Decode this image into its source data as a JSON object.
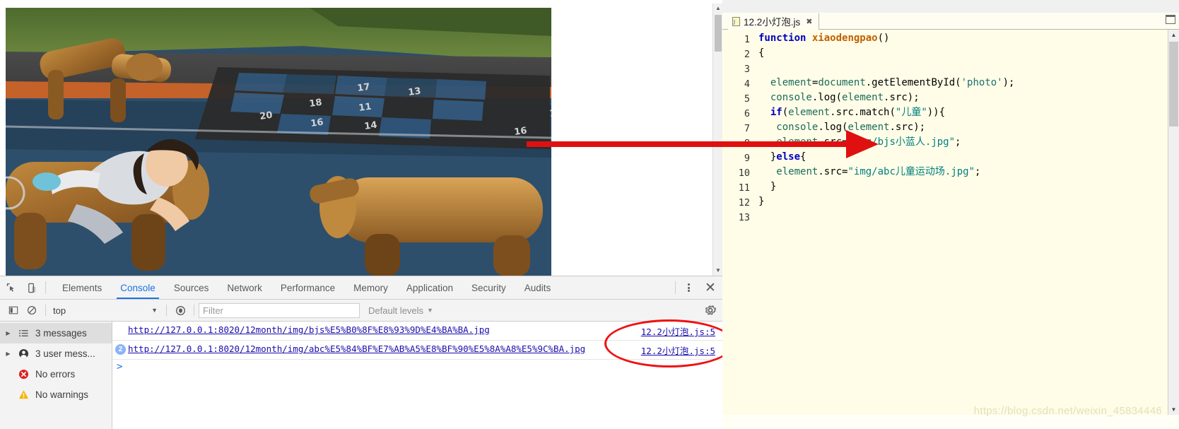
{
  "browser": {
    "photo_alt": "children playground with wooden horse logs and numbered hopscotch grid",
    "scrollbar": {
      "up": "▲",
      "down": "▼"
    }
  },
  "devtools": {
    "tabs": [
      {
        "label": "Elements",
        "active": false
      },
      {
        "label": "Console",
        "active": true
      },
      {
        "label": "Sources",
        "active": false
      },
      {
        "label": "Network",
        "active": false
      },
      {
        "label": "Performance",
        "active": false
      },
      {
        "label": "Memory",
        "active": false
      },
      {
        "label": "Application",
        "active": false
      },
      {
        "label": "Security",
        "active": false
      },
      {
        "label": "Audits",
        "active": false
      }
    ],
    "icons": {
      "inspect": "inspect-element-icon",
      "device": "device-toolbar-icon",
      "more": "more-options-icon",
      "close": "✕",
      "sidebar": "console-sidebar-icon",
      "clear": "clear-console-icon",
      "eye": "live-expression-icon",
      "settings": "settings-gear-icon"
    },
    "filterbar": {
      "context": "top",
      "context_caret": "▼",
      "filter_placeholder": "Filter",
      "filter_value": "",
      "levels": "Default levels",
      "levels_caret": "▼"
    },
    "sidebar": {
      "items": [
        {
          "label": "3 messages",
          "icon": "list-icon",
          "expandable": true,
          "selected": true
        },
        {
          "label": "3 user mess...",
          "icon": "user-icon",
          "expandable": true,
          "selected": false
        },
        {
          "label": "No errors",
          "icon": "error-icon",
          "expandable": false,
          "selected": false
        },
        {
          "label": "No warnings",
          "icon": "warning-icon",
          "expandable": false,
          "selected": false
        }
      ],
      "triangle": "▶"
    },
    "messages": [
      {
        "badge": "",
        "url": "http://127.0.0.1:8020/12month/img/bjs%E5%B0%8F%E8%93%9D%E4%BA%BA.jpg",
        "source": "12.2小灯泡.js:5"
      },
      {
        "badge": "2",
        "url": "http://127.0.0.1:8020/12month/img/abc%E5%84%BF%E7%AB%A5%E8%BF%90%E5%8A%A8%E5%9C%BA.jpg",
        "source": "12.2小灯泡.js:5"
      }
    ],
    "prompt_chevron": ">"
  },
  "editor": {
    "tab_title": "12.2小灯泡.js",
    "tab_close": "✖",
    "minimize": "—",
    "highlight_line": 9,
    "lines": [
      {
        "n": "1",
        "fold": "−",
        "text": "function xiaodengpao()"
      },
      {
        "n": "2",
        "fold": "",
        "text": "{"
      },
      {
        "n": "3",
        "fold": "",
        "text": ""
      },
      {
        "n": "4",
        "fold": "",
        "text": "  element=document.getElementById('photo');"
      },
      {
        "n": "5",
        "fold": "",
        "text": "  console.log(element.src);"
      },
      {
        "n": "6",
        "fold": "−",
        "text": "  if(element.src.match(\"儿童\")){"
      },
      {
        "n": "7",
        "fold": "",
        "text": "   console.log(element.src);"
      },
      {
        "n": "8",
        "fold": "",
        "text": "   element.src=\"img/bjs小蓝人.jpg\";"
      },
      {
        "n": "9",
        "fold": "−",
        "text": "  }else{"
      },
      {
        "n": "10",
        "fold": "",
        "text": "   element.src=\"img/abc儿童运动场.jpg\";"
      },
      {
        "n": "11",
        "fold": "",
        "text": "  }"
      },
      {
        "n": "12",
        "fold": "",
        "text": "}"
      },
      {
        "n": "13",
        "fold": "",
        "text": ""
      }
    ],
    "scroll": {
      "up": "▲",
      "down": "▼"
    }
  },
  "annotations": {
    "arrow_color": "#e01010",
    "ellipse_color": "#ee1111",
    "arrow_target_line": 7
  },
  "watermark": "https://blog.csdn.net/weixin_45834446",
  "colors": {
    "accent": "#1a73e8",
    "link": "#1a0dab",
    "editor_bg": "#fffde7",
    "devtools_bg": "#f3f3f3"
  }
}
